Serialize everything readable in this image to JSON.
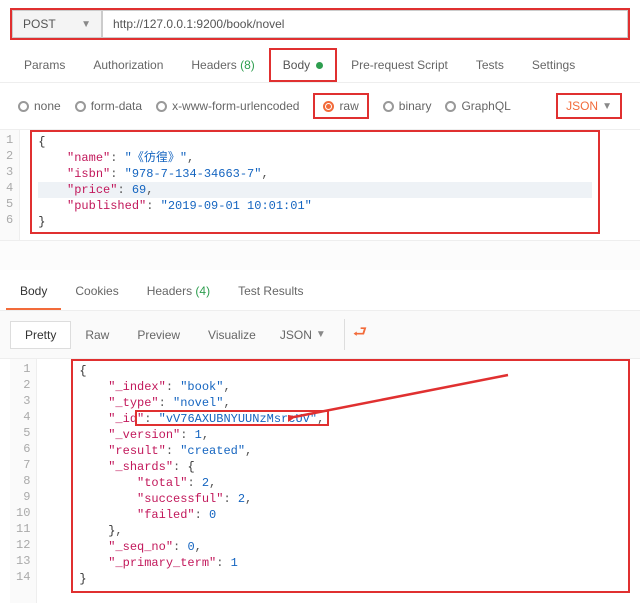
{
  "request": {
    "method": "POST",
    "url": "http://127.0.0.1:9200/book/novel"
  },
  "req_tabs": {
    "params": "Params",
    "auth": "Authorization",
    "headers": "Headers",
    "headers_count": "(8)",
    "body": "Body",
    "prereq": "Pre-request Script",
    "tests": "Tests",
    "settings": "Settings"
  },
  "body_types": {
    "none": "none",
    "formdata": "form-data",
    "urlencoded": "x-www-form-urlencoded",
    "raw": "raw",
    "binary": "binary",
    "graphql": "GraphQL",
    "json": "JSON"
  },
  "req_body": {
    "l1": "{",
    "k_name": "\"name\"",
    "v_name": "\"《彷徨》\"",
    "k_isbn": "\"isbn\"",
    "v_isbn": "\"978-7-134-34663-7\"",
    "k_price": "\"price\"",
    "v_price": "69",
    "k_pub": "\"published\"",
    "v_pub": "\"2019-09-01 10:01:01\"",
    "l6": "}"
  },
  "resp_tabs": {
    "body": "Body",
    "cookies": "Cookies",
    "headers": "Headers",
    "headers_count": "(4)",
    "results": "Test Results"
  },
  "resp_toolbar": {
    "pretty": "Pretty",
    "raw": "Raw",
    "preview": "Preview",
    "visualize": "Visualize",
    "json": "JSON"
  },
  "resp_body": {
    "k_index": "\"_index\"",
    "v_index": "\"book\"",
    "k_type": "\"_type\"",
    "v_type": "\"novel\"",
    "k_id": "\"_id\"",
    "v_id": "\"vV76AXUBNYUUNzMsrcUv\"",
    "k_ver": "\"_version\"",
    "v_ver": "1",
    "k_res": "\"result\"",
    "v_res": "\"created\"",
    "k_shards": "\"_shards\"",
    "k_total": "\"total\"",
    "v_total": "2",
    "k_succ": "\"successful\"",
    "v_succ": "2",
    "k_fail": "\"failed\"",
    "v_fail": "0",
    "k_seq": "\"_seq_no\"",
    "v_seq": "0",
    "k_prim": "\"_primary_term\"",
    "v_prim": "1"
  }
}
